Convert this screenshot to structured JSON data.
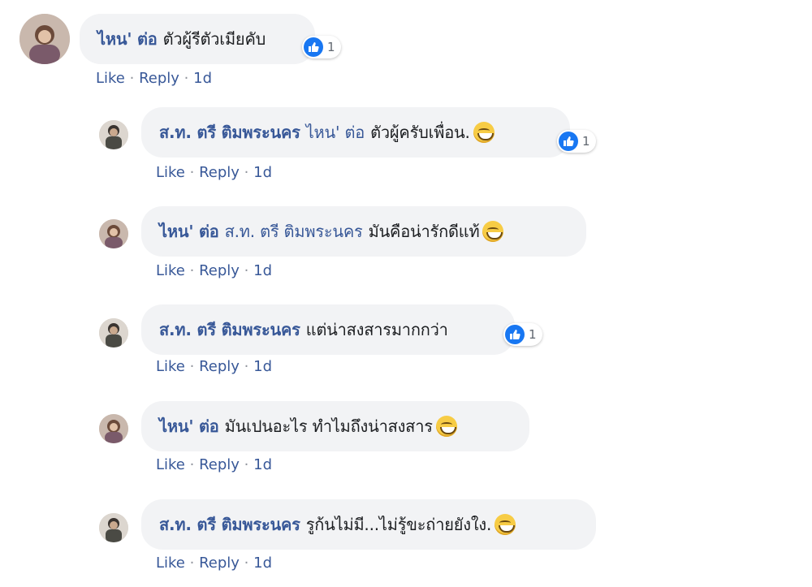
{
  "comments": [
    {
      "author": "ไหน' ต่อ",
      "tag": "",
      "text": "ตัวผู้รีตัวเมียคับ",
      "emoji": "",
      "reactions": "1",
      "like": "Like",
      "reply": "Reply",
      "time": "1d"
    },
    {
      "author": "ส.ท. ตรี ติมพระนคร",
      "tag": "ไหน' ต่อ",
      "text": "ตัวผู้ครับเพื่อน.",
      "emoji": "grinning-sweat-emoji",
      "reactions": "1",
      "like": "Like",
      "reply": "Reply",
      "time": "1d"
    },
    {
      "author": "ไหน' ต่อ",
      "tag": "ส.ท. ตรี ติมพระนคร",
      "text": "มันคือน่ารักดีแท้",
      "emoji": "laughing-emoji",
      "reactions": "",
      "like": "Like",
      "reply": "Reply",
      "time": "1d"
    },
    {
      "author": "ส.ท. ตรี ติมพระนคร",
      "tag": "",
      "text": "แต่น่าสงสารมากกว่า",
      "emoji": "",
      "reactions": "1",
      "like": "Like",
      "reply": "Reply",
      "time": "1d"
    },
    {
      "author": "ไหน' ต่อ",
      "tag": "",
      "text": "มันเปนอะไร ทำไมถึงน่าสงสาร",
      "emoji": "grinning-sweat-emoji",
      "reactions": "",
      "like": "Like",
      "reply": "Reply",
      "time": "1d"
    },
    {
      "author": "ส.ท. ตรี ติมพระนคร",
      "tag": "",
      "text": "รูก้นไม่มี...ไม่รู้ขะถ่ายยังใง.",
      "emoji": "grinning-sweat-emoji",
      "reactions": "",
      "like": "Like",
      "reply": "Reply",
      "time": "1d"
    }
  ],
  "separator": "·",
  "colors": {
    "bubble": "#f2f3f5",
    "link": "#385898",
    "like_blue": "#1877f2"
  }
}
